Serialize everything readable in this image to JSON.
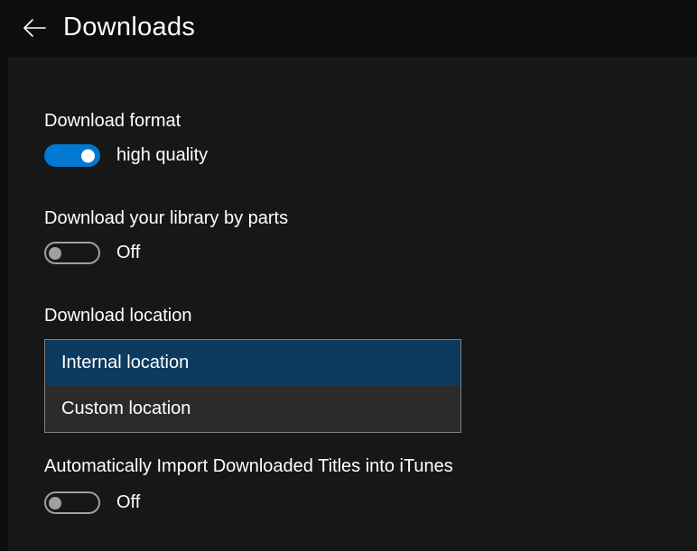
{
  "header": {
    "title": "Downloads"
  },
  "settings": {
    "format": {
      "label": "Download format",
      "value": "high quality",
      "toggled": true
    },
    "libraryParts": {
      "label": "Download your library by parts",
      "value": "Off",
      "toggled": false
    },
    "location": {
      "label": "Download location",
      "options": [
        {
          "label": "Internal location",
          "selected": true
        },
        {
          "label": "Custom location",
          "selected": false
        }
      ]
    },
    "itunesImport": {
      "label": "Automatically Import Downloaded Titles into iTunes",
      "value": "Off",
      "toggled": false
    }
  }
}
